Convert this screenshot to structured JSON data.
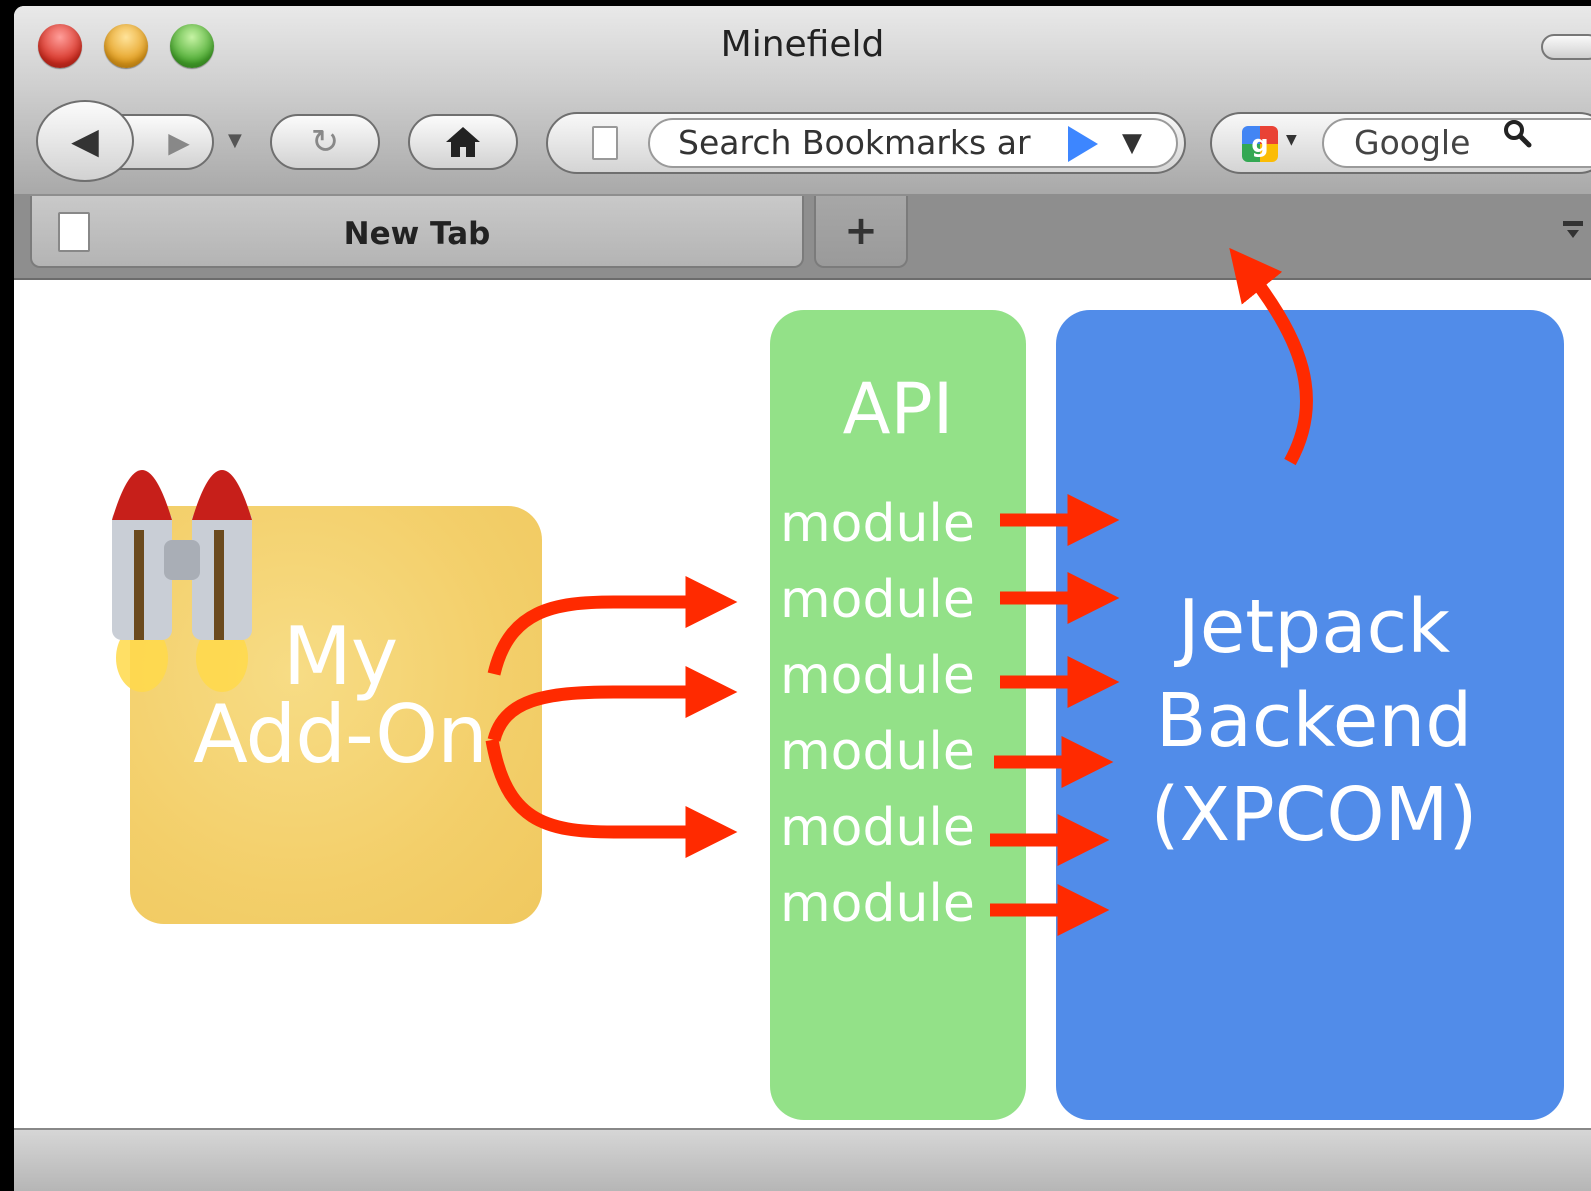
{
  "window": {
    "title": "Minefield"
  },
  "toolbar": {
    "url_placeholder": "Search Bookmarks ar",
    "search_engine": "Google"
  },
  "tabs": [
    {
      "label": "New Tab"
    }
  ],
  "new_tab_label": "+",
  "diagram": {
    "addon_label": "My\nAdd-On",
    "api_label": "API",
    "modules": [
      "module",
      "module",
      "module",
      "module",
      "module",
      "module"
    ],
    "backend_label": "Jetpack\nBackend\n(XPCOM)",
    "arrow_color": "#ff2a00",
    "colors": {
      "addon": "#f3cf6a",
      "api": "#93e188",
      "backend": "#518ce9"
    }
  },
  "icons": {
    "back": "back-arrow-icon",
    "forward": "forward-arrow-icon",
    "reload": "reload-icon",
    "home": "home-icon",
    "page": "page-icon",
    "go": "go-arrow-icon",
    "google": "google-icon",
    "search": "search-icon",
    "jetpack": "jetpack-rocket-icon"
  }
}
